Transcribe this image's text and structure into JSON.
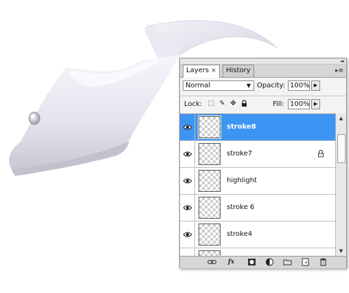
{
  "panel": {
    "tabs": [
      {
        "label": "Layers",
        "close": "×",
        "active": true
      },
      {
        "label": "History",
        "active": false
      }
    ],
    "menu_icon": "▸≡",
    "collapse_icon": "◂◂"
  },
  "options": {
    "blend_mode": "Normal",
    "opacity_label": "Opacity:",
    "opacity_value": "100%",
    "lock_label": "Lock:",
    "fill_label": "Fill:",
    "fill_value": "100%"
  },
  "layers": [
    {
      "name": "stroke8",
      "selected": true,
      "visible": true,
      "locked": false
    },
    {
      "name": "stroke7",
      "selected": false,
      "visible": true,
      "locked": true
    },
    {
      "name": "highlight",
      "selected": false,
      "visible": true,
      "locked": false
    },
    {
      "name": "stroke 6",
      "selected": false,
      "visible": true,
      "locked": false
    },
    {
      "name": "stroke4",
      "selected": false,
      "visible": true,
      "locked": false
    }
  ],
  "bottom_icons": [
    "link-icon",
    "fx-icon",
    "mask-icon",
    "adjustment-icon",
    "group-folder-icon",
    "new-layer-icon",
    "trash-icon"
  ],
  "colors": {
    "selection": "#3d95f3",
    "shape_light": "#f4f3f8",
    "shape_dark": "#c9c7d3"
  }
}
